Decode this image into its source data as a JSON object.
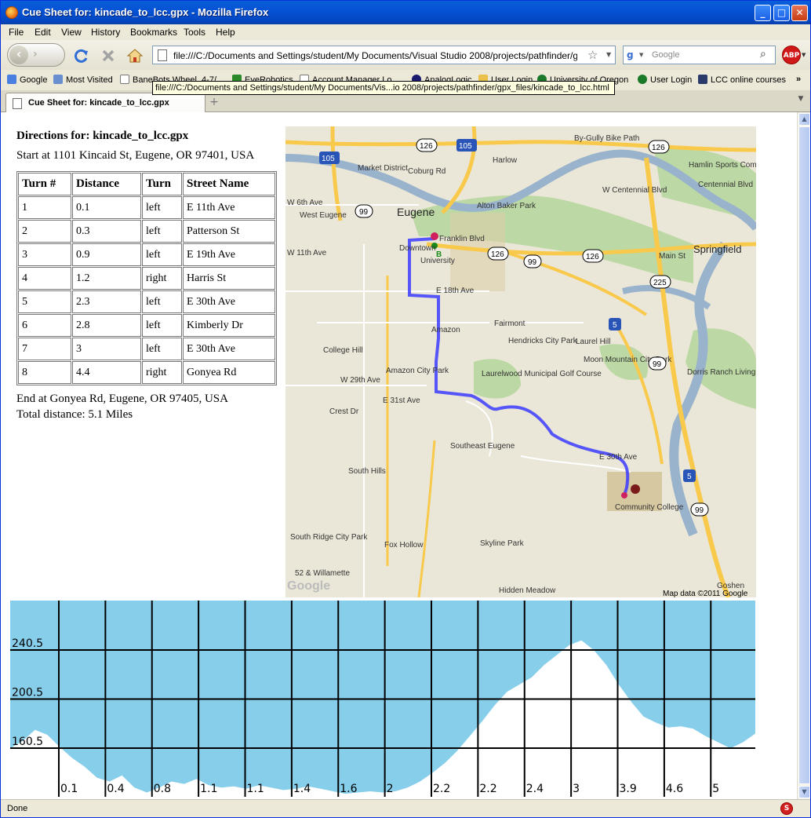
{
  "window": {
    "title": "Cue Sheet for: kincade_to_lcc.gpx - Mozilla Firefox"
  },
  "menu": [
    "File",
    "Edit",
    "View",
    "History",
    "Bookmarks",
    "Tools",
    "Help"
  ],
  "toolbar": {
    "url": "file:///C:/Documents and Settings/student/My Documents/Visual Studio 2008/projects/pathfinder/gpx_files/k",
    "search_placeholder": "Google",
    "tooltip": "file:///C:/Documents and Settings/student/My Documents/Vis...io 2008/projects/pathfinder/gpx_files/kincade_to_lcc.html"
  },
  "bookmarks": [
    {
      "label": "Google",
      "icon": "google-icon"
    },
    {
      "label": "Most Visited",
      "icon": "most-visited-icon"
    },
    {
      "label": "BaneBots Wheel, 4-7/...",
      "icon": "page-icon"
    },
    {
      "label": "EyeRobotics",
      "icon": "bug-icon"
    },
    {
      "label": "Account Manager Lo...",
      "icon": "page-icon"
    },
    {
      "label": "AnalogLogic",
      "icon": "circle-icon"
    },
    {
      "label": "User Login",
      "icon": "folder-icon"
    },
    {
      "label": "University of Oregon",
      "icon": "o-icon"
    },
    {
      "label": "User Login",
      "icon": "o-icon"
    },
    {
      "label": "LCC online courses",
      "icon": "columns-icon"
    }
  ],
  "tab": {
    "label": "Cue Sheet for: kincade_to_lcc.gpx"
  },
  "status": "Done",
  "page": {
    "heading": "Directions for: kincade_to_lcc.gpx",
    "start": "Start at 1101 Kincaid St, Eugene, OR 97401, USA",
    "headers": [
      "Turn #",
      "Distance",
      "Turn",
      "Street Name"
    ],
    "rows": [
      [
        "1",
        "0.1",
        "left",
        "E 11th Ave"
      ],
      [
        "2",
        "0.3",
        "left",
        "Patterson St"
      ],
      [
        "3",
        "0.9",
        "left",
        "E 19th Ave"
      ],
      [
        "4",
        "1.2",
        "right",
        "Harris St"
      ],
      [
        "5",
        "2.3",
        "left",
        "E 30th Ave"
      ],
      [
        "6",
        "2.8",
        "left",
        "Kimberly Dr"
      ],
      [
        "7",
        "3",
        "left",
        "E 30th Ave"
      ],
      [
        "8",
        "4.4",
        "right",
        "Gonyea Rd"
      ]
    ],
    "end": "End at Gonyea Rd, Eugene, OR 97405, USA",
    "total": "Total distance: 5.1 Miles"
  },
  "map": {
    "credit": "Map data ©2011 Google",
    "labels": [
      "Eugene",
      "Springfield",
      "Downtown",
      "University",
      "Market District",
      "West Eugene",
      "Harlow",
      "Alton Baker Park",
      "Hamlin Sports Complex",
      "Centennial Blvd",
      "W Centennial Blvd",
      "Fairmont",
      "Hendricks City Park",
      "Laurel Hill",
      "Moon Mountain City Park",
      "Dorris Ranch Living History Farm",
      "Amazon",
      "Amazon City Park",
      "Laurelwood Municipal Golf Course",
      "College Hill",
      "Southeast Eugene",
      "South Hills",
      "Fox Hollow",
      "Skyline Park",
      "Community College",
      "South Ridge City Park",
      "52 & Willamette",
      "Hidden Meadow",
      "Goshen",
      "By-Gully Bike Path",
      "Franklin Blvd",
      "E 18th Ave",
      "E 30th Ave",
      "W 29th Ave",
      "E 31st Ave",
      "Crest Dr",
      "Main St",
      "W 6th Ave",
      "W 11th Ave",
      "Coburg Rd"
    ],
    "shields": [
      "105",
      "126",
      "105",
      "126",
      "99",
      "126",
      "99",
      "126",
      "225",
      "5",
      "99",
      "5",
      "99"
    ],
    "markers": [
      "A",
      "B"
    ]
  },
  "chart_data": {
    "type": "area",
    "title": "",
    "xlabel": "",
    "ylabel": "",
    "y_ticks": [
      "160.5",
      "200.5",
      "240.5"
    ],
    "x_tick_labels": [
      "0.1",
      "0.4",
      "0.8",
      "1.1",
      "1.1",
      "1.4",
      "1.6",
      "2",
      "2.2",
      "2.2",
      "2.4",
      "3",
      "3.9",
      "4.6",
      "5"
    ],
    "ylim": [
      120.5,
      280.5
    ],
    "series": [
      {
        "values": [
          160,
          166,
          175,
          171,
          161,
          152,
          145,
          136,
          133,
          138,
          128,
          124,
          128,
          133,
          131,
          135,
          130,
          128,
          129,
          127,
          130,
          128,
          126,
          127,
          129,
          127,
          125,
          123,
          124,
          125,
          124,
          125,
          128,
          133,
          140,
          148,
          158,
          170,
          182,
          195,
          206,
          212,
          218,
          228,
          236,
          244,
          248,
          240,
          228,
          212,
          198,
          186,
          181,
          177,
          178,
          176,
          170,
          165,
          160,
          165,
          172
        ]
      }
    ],
    "colors": {
      "sky": "#87ceeb",
      "grid": "#000000"
    }
  }
}
